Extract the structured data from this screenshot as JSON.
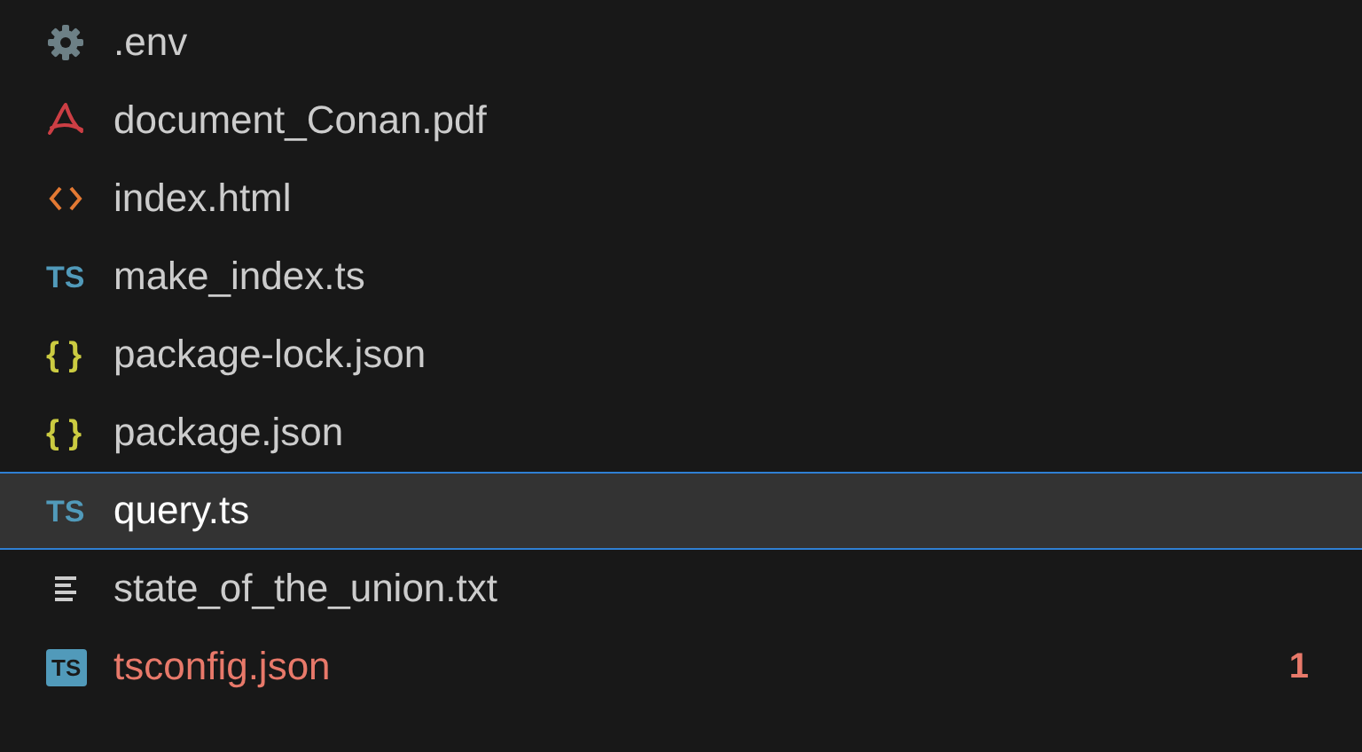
{
  "files": [
    {
      "name": ".env",
      "kind": "settings",
      "selected": false,
      "error": false
    },
    {
      "name": "document_Conan.pdf",
      "kind": "pdf",
      "selected": false,
      "error": false
    },
    {
      "name": "index.html",
      "kind": "markup",
      "selected": false,
      "error": false
    },
    {
      "name": "make_index.ts",
      "kind": "script",
      "icon_text": "TS",
      "selected": false,
      "error": false
    },
    {
      "name": "package-lock.json",
      "kind": "data",
      "icon_text": "{ }",
      "selected": false,
      "error": false
    },
    {
      "name": "package.json",
      "kind": "data",
      "icon_text": "{ }",
      "selected": false,
      "error": false
    },
    {
      "name": "query.ts",
      "kind": "script",
      "icon_text": "TS",
      "selected": true,
      "error": false
    },
    {
      "name": "state_of_the_union.txt",
      "kind": "text",
      "selected": false,
      "error": false
    },
    {
      "name": "tsconfig.json",
      "kind": "config",
      "icon_text": "TS",
      "selected": false,
      "error": true,
      "problems": "1"
    }
  ]
}
